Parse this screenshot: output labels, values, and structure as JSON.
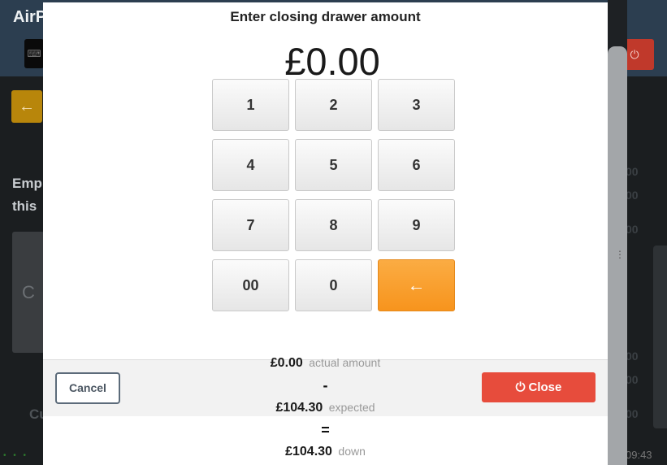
{
  "background": {
    "logo": "AirP",
    "keyboard_icon": "keyboard-icon",
    "power_icon": "power-icon",
    "back_arrow": "←",
    "employee_line1": "Emp",
    "employee_line2": "this",
    "card_letter": "C",
    "cu_label": "Cu",
    "right_values": [
      "00",
      "00",
      "00",
      "00",
      "00",
      "00"
    ],
    "time": "09:43"
  },
  "modal": {
    "title": "Enter closing drawer amount",
    "amount": "£0.00",
    "keypad": {
      "keys": [
        "1",
        "2",
        "3",
        "4",
        "5",
        "6",
        "7",
        "8",
        "9",
        "00",
        "0"
      ],
      "backspace": "←"
    },
    "summary": {
      "actual_value": "£0.00",
      "actual_label": "actual amount",
      "minus": "-",
      "expected_value": "£104.30",
      "expected_label": "expected",
      "equals": "=",
      "down_value": "£104.30",
      "down_label": "down"
    },
    "cancel_label": "Cancel",
    "close_label": "Close",
    "close_icon": "power-icon"
  },
  "colors": {
    "close_button": "#e74c3c",
    "backspace_key": "#f7941d",
    "header": "#2c3e50"
  }
}
